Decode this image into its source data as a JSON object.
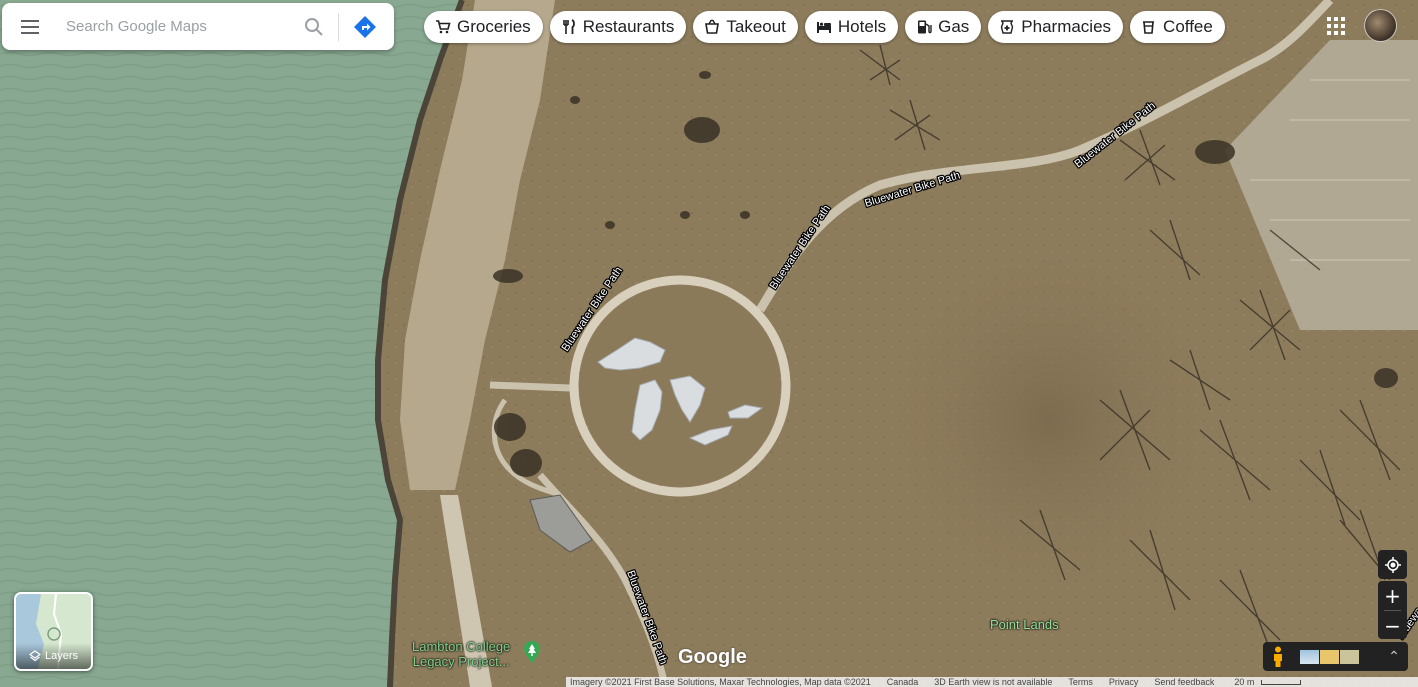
{
  "search": {
    "placeholder": "Search Google Maps"
  },
  "categories": [
    {
      "label": "Groceries",
      "icon": "cart-icon"
    },
    {
      "label": "Restaurants",
      "icon": "fork-knife-icon"
    },
    {
      "label": "Takeout",
      "icon": "takeout-icon"
    },
    {
      "label": "Hotels",
      "icon": "bed-icon"
    },
    {
      "label": "Gas",
      "icon": "gas-pump-icon"
    },
    {
      "label": "Pharmacies",
      "icon": "pharmacy-icon"
    },
    {
      "label": "Coffee",
      "icon": "coffee-cup-icon"
    }
  ],
  "map": {
    "path_labels": [
      "Bluewater Bike Path",
      "Bluewater Bike Path",
      "Bluewater Bike Path",
      "Bluewater Bike Path",
      "Bluewater Bike Path",
      "Bluewa"
    ],
    "poi": {
      "line1": "Lambton College",
      "line2": "Legacy Project..."
    },
    "place": "Point Lands",
    "logo": "Google",
    "layers_label": "Layers"
  },
  "footer": {
    "imagery": "Imagery ©2021 First Base Solutions, Maxar Technologies, Map data ©2021",
    "country": "Canada",
    "earth_view": "3D Earth view is not available",
    "terms": "Terms",
    "privacy": "Privacy",
    "feedback": "Send feedback",
    "scale": "20 m"
  },
  "colors": {
    "water": "#88a891",
    "land": "#8c7b5b",
    "chip_bg": "#ffffff",
    "directions": "#1a73e8"
  }
}
